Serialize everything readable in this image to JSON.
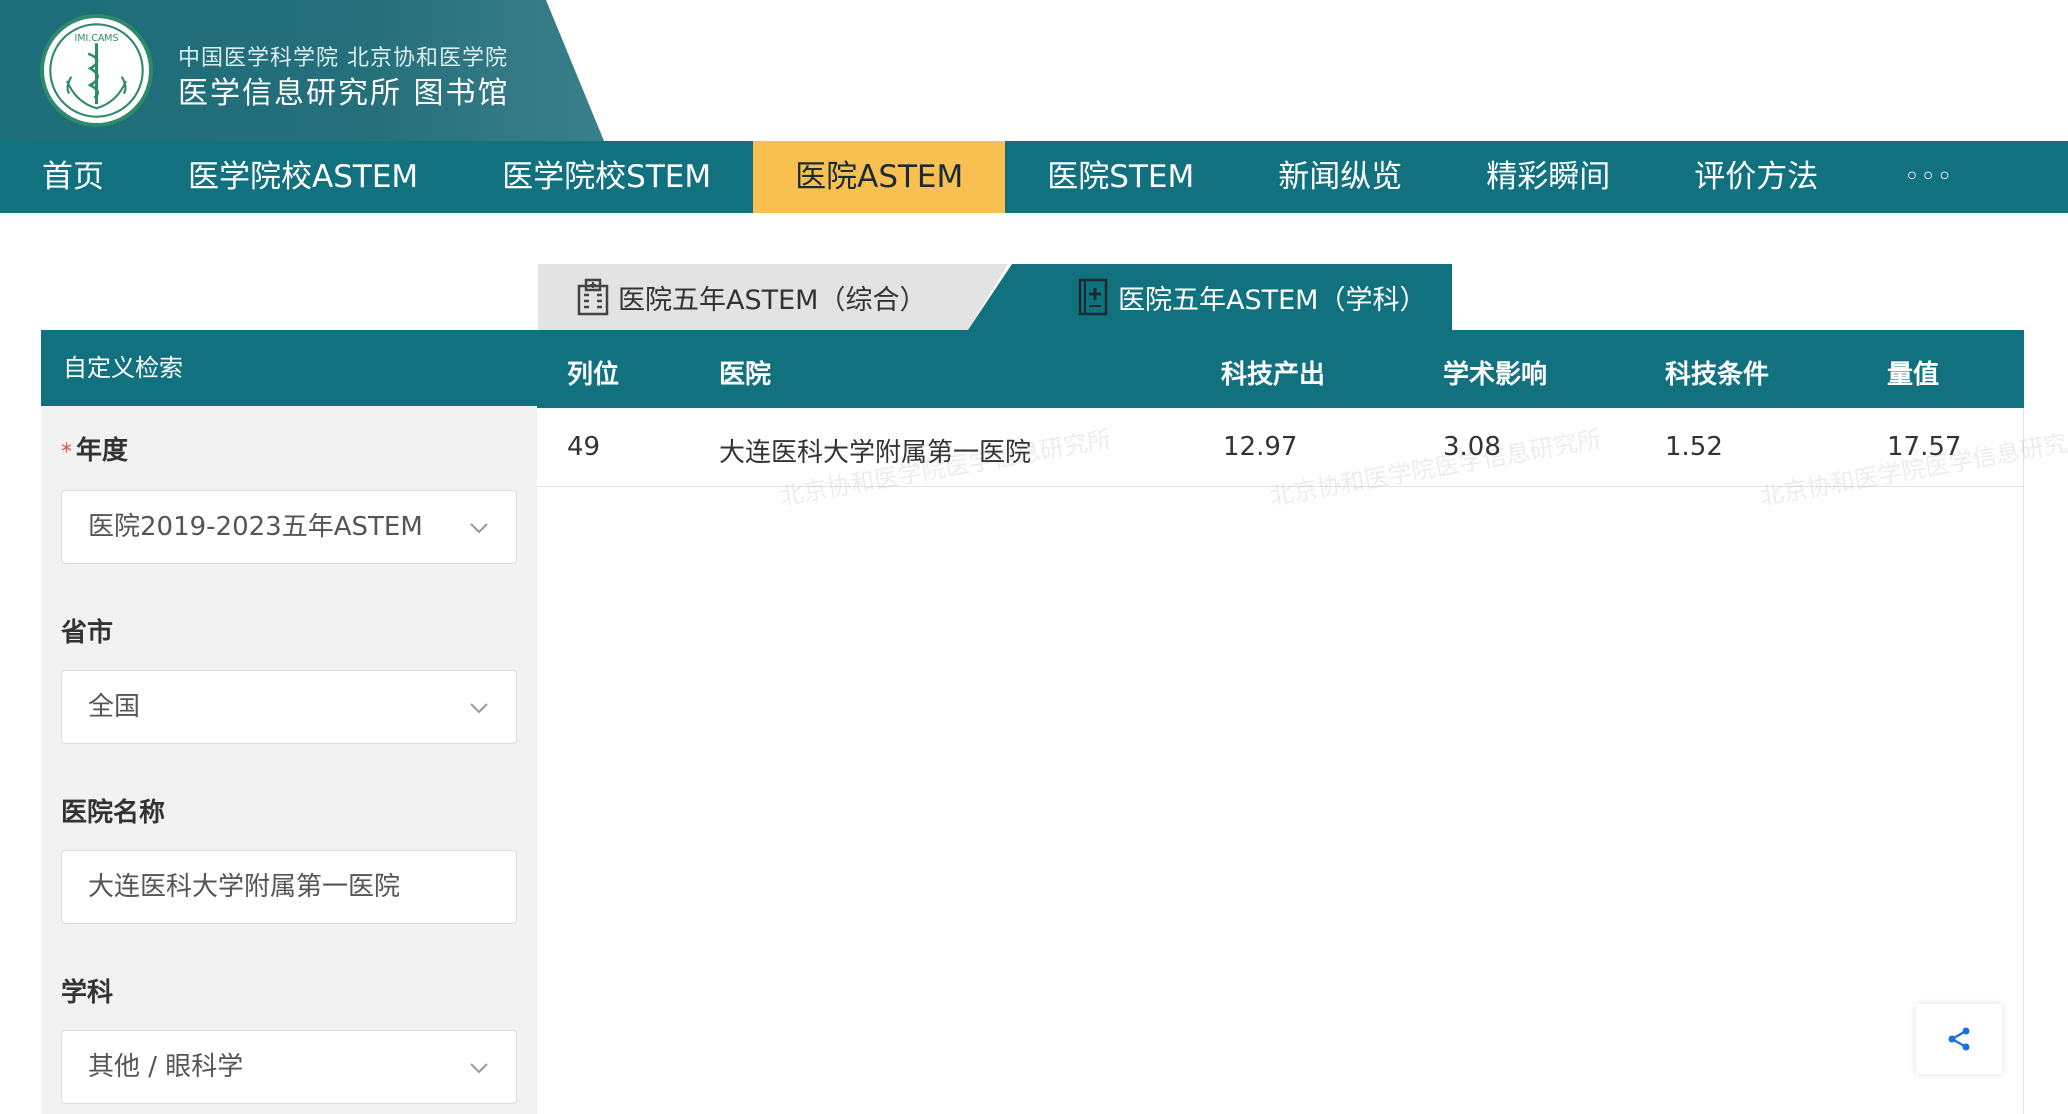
{
  "header": {
    "org_line1": "中国医学科学院 北京协和医学院",
    "org_line2": "医学信息研究所 图书馆",
    "logo_text": "IMI.CAMS"
  },
  "nav": {
    "items": [
      {
        "label": "首页"
      },
      {
        "label": "医学院校ASTEM"
      },
      {
        "label": "医学院校STEM"
      },
      {
        "label": "医院ASTEM",
        "active": true
      },
      {
        "label": "医院STEM"
      },
      {
        "label": "新闻纵览"
      },
      {
        "label": "精彩瞬间"
      },
      {
        "label": "评价方法"
      }
    ],
    "more": "◦◦◦"
  },
  "tabs": {
    "overall": "医院五年ASTEM（综合）",
    "subject": "医院五年ASTEM（学科）"
  },
  "filter": {
    "title": "自定义检索",
    "year_label": "年度",
    "year_value": "医院2019-2023五年ASTEM",
    "province_label": "省市",
    "province_value": "全国",
    "hospital_label": "医院名称",
    "hospital_value": "大连医科大学附属第一医院",
    "subject_label": "学科",
    "subject_value": "其他 / 眼科学"
  },
  "table": {
    "headers": [
      "列位",
      "医院",
      "科技产出",
      "学术影响",
      "科技条件",
      "量值"
    ],
    "rows": [
      {
        "rank": "49",
        "hospital": "大连医科大学附属第一医院",
        "output": "12.97",
        "influence": "3.08",
        "condition": "1.52",
        "value": "17.57"
      }
    ]
  },
  "colors": {
    "primary": "#12717f",
    "active_tab": "#f8c051",
    "panel_bg": "#f2f2f2"
  }
}
